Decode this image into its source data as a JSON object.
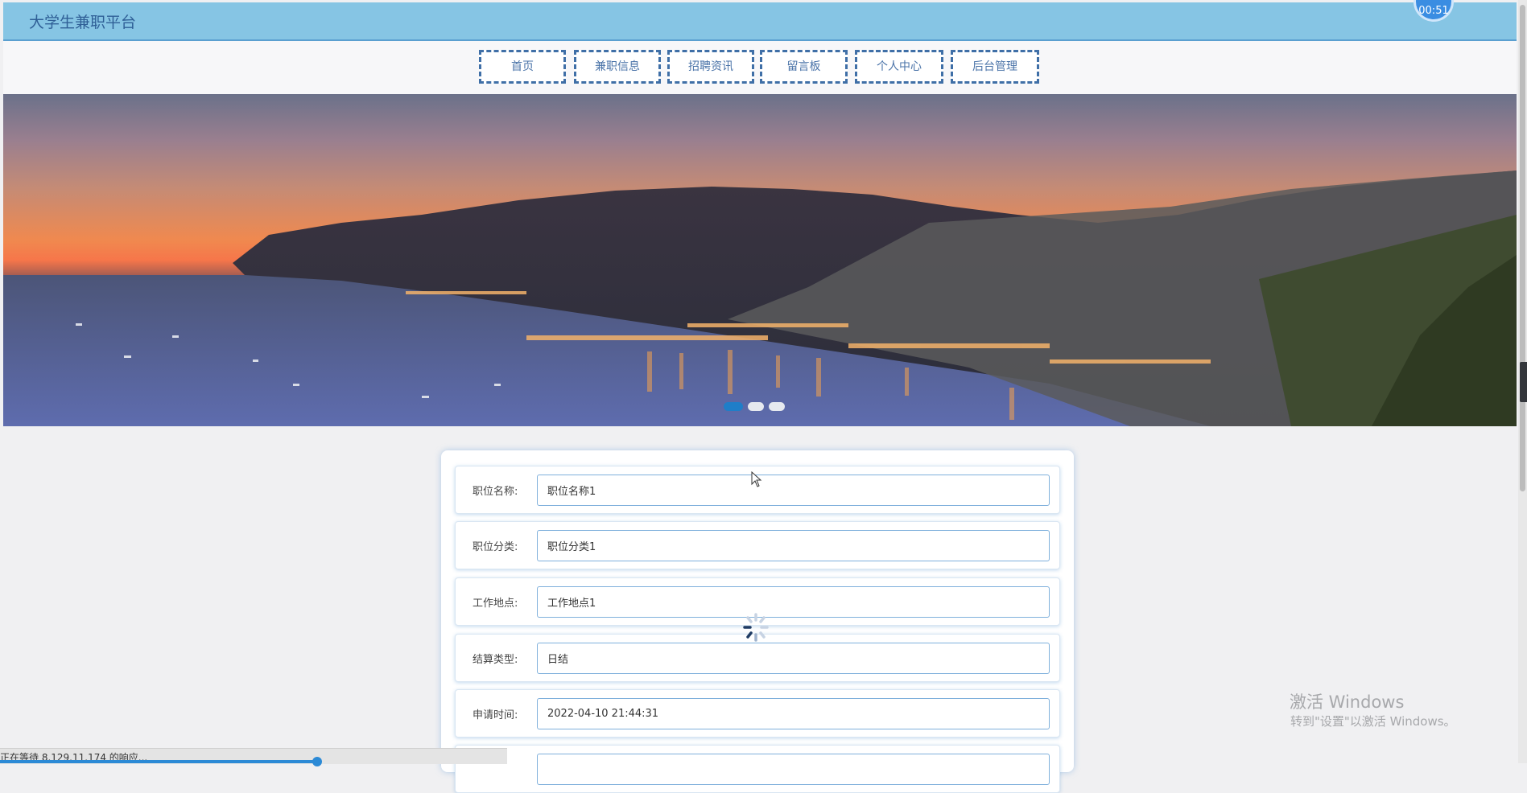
{
  "header": {
    "brand": "大学生兼职平台",
    "timer": "00:51"
  },
  "nav": {
    "items": [
      {
        "label": "首页"
      },
      {
        "label": "兼职信息"
      },
      {
        "label": "招聘资讯"
      },
      {
        "label": "留言板"
      },
      {
        "label": "个人中心"
      },
      {
        "label": "后台管理"
      }
    ]
  },
  "banner": {
    "slide_count": 3,
    "active_slide": 1
  },
  "form": {
    "fields": [
      {
        "label": "职位名称:",
        "value": "职位名称1"
      },
      {
        "label": "职位分类:",
        "value": "职位分类1"
      },
      {
        "label": "工作地点:",
        "value": "工作地点1"
      },
      {
        "label": "结算类型:",
        "value": "日结"
      },
      {
        "label": "申请时间:",
        "value": "2022-04-10 21:44:31"
      }
    ]
  },
  "status": {
    "text": "正在等待 8.129.11.174 的响应..."
  },
  "watermark": {
    "line1": "激活 Windows",
    "line2": "转到\"设置\"以激活 Windows。"
  },
  "colors": {
    "header_bg": "#86c5e4",
    "nav_border": "#3f6fa7",
    "accent": "#1f7ec8"
  }
}
